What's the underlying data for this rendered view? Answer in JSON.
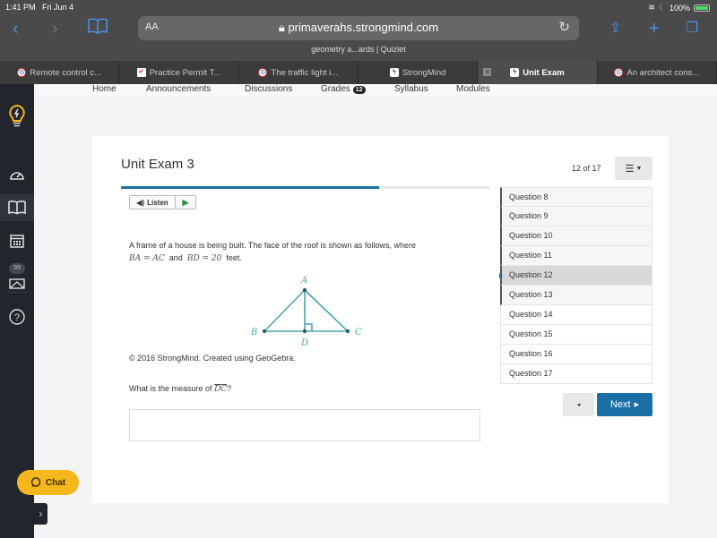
{
  "status_bar": {
    "time": "1:41 PM",
    "date": "Fri Jun 4",
    "battery": "100%"
  },
  "browser": {
    "text_size_label": "AA",
    "url": "primaverahs.strongmind.com",
    "page_subtitle": "geometry a...ards | Quizlet",
    "tabs": [
      {
        "title": "Remote control c...",
        "icon": "google-icon",
        "active": false
      },
      {
        "title": "Practice Permit T...",
        "icon": "checkmark-icon",
        "active": false
      },
      {
        "title": "The traffic light i...",
        "icon": "google-icon",
        "active": false
      },
      {
        "title": "StrongMind",
        "icon": "strongmind-icon",
        "active": false
      },
      {
        "title": "Unit Exam",
        "icon": "strongmind-icon",
        "active": true
      },
      {
        "title": "An architect cons...",
        "icon": "google-icon",
        "active": false
      }
    ]
  },
  "sidebar": {
    "items": [
      {
        "icon": "lightbulb-logo-icon"
      },
      {
        "icon": "dashboard-gauge-icon"
      },
      {
        "icon": "book-icon",
        "active": true
      },
      {
        "icon": "calendar-icon"
      },
      {
        "icon": "mail-icon",
        "badge": "99"
      },
      {
        "icon": "help-icon"
      }
    ]
  },
  "topnav": {
    "items": [
      "Home",
      "Announcements",
      "Discussions",
      "Grades",
      "Syllabus",
      "Modules"
    ],
    "grades_badge": "12"
  },
  "exam": {
    "title": "Unit Exam 3",
    "counter": "12 of 17",
    "progress_fraction": 0.7,
    "listen_label": "Listen",
    "question_text_1": "A frame of a house is being built. The face of the roof is shown as follows, where",
    "math_eq_1": "BA = AC",
    "and_label": "and",
    "math_eq_2": "BD = 20",
    "feet_label": "feet.",
    "diagram_labels": {
      "a": "A",
      "b": "B",
      "c": "C",
      "d": "D"
    },
    "diagram_color": "#4aa3b4",
    "copyright": "© 2016 StrongMind. Created using GeoGebra.",
    "question_prefix": "What is the measure of",
    "segment": "DC",
    "question_suffix": "?",
    "answer_value": "",
    "questions": [
      {
        "label": "Question 8",
        "state": "visited"
      },
      {
        "label": "Question 9",
        "state": "visited"
      },
      {
        "label": "Question 10",
        "state": "visited"
      },
      {
        "label": "Question 11",
        "state": "visited"
      },
      {
        "label": "Question 12",
        "state": "current"
      },
      {
        "label": "Question 13",
        "state": "visited"
      },
      {
        "label": "Question 14",
        "state": "unvisited"
      },
      {
        "label": "Question 15",
        "state": "unvisited"
      },
      {
        "label": "Question 16",
        "state": "unvisited"
      },
      {
        "label": "Question 17",
        "state": "unvisited"
      }
    ],
    "prev_label": "◂",
    "next_label": "Next",
    "accent_color": "#1a6fa4"
  },
  "chat": {
    "label": "Chat"
  }
}
